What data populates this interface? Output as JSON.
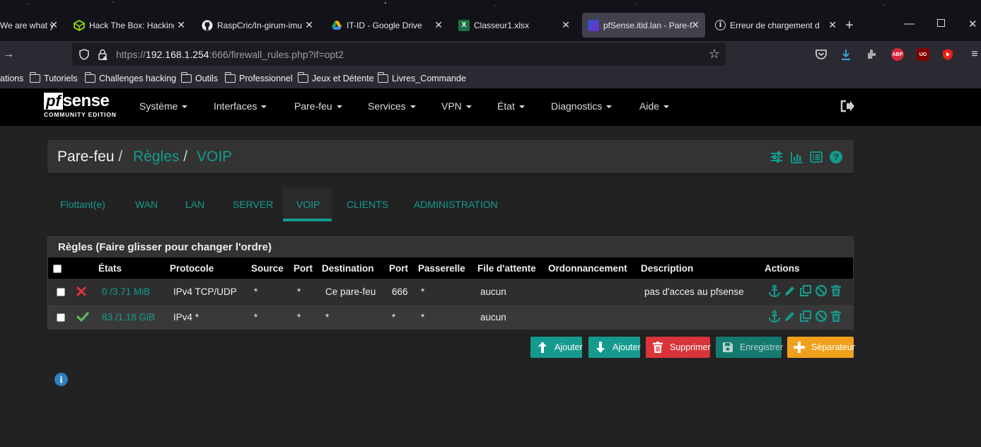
{
  "browser": {
    "tabs": [
      {
        "label": "We are what y",
        "favicon": "generic"
      },
      {
        "label": "Hack The Box: Hacking",
        "favicon": "htb-cube"
      },
      {
        "label": "RaspCric/In-girum-imu",
        "favicon": "github"
      },
      {
        "label": "IT-ID - Google Drive",
        "favicon": "google-drive"
      },
      {
        "label": "Classeur1.xlsx",
        "favicon": "excel"
      },
      {
        "label": "pfSense.itid.lan - Pare-f",
        "favicon": "pfsense",
        "active": true
      },
      {
        "label": "Erreur de chargement d",
        "favicon": "info"
      }
    ],
    "url_prefix": "https://",
    "url_host": "192.168.1.254",
    "url_rest": ":666/firewall_rules.php?if=opt2",
    "toolbar_badges": {
      "abp": "ABP",
      "ublock": "UO"
    },
    "bookmarks": [
      {
        "label": "ations",
        "type": "plain"
      },
      {
        "label": "Tutoriels",
        "type": "folder"
      },
      {
        "label": "Challenges hacking",
        "type": "folder"
      },
      {
        "label": "Outils",
        "type": "folder"
      },
      {
        "label": "Professionnel",
        "type": "folder"
      },
      {
        "label": "Jeux et Détente",
        "type": "folder"
      },
      {
        "label": "Livres_Commande",
        "type": "folder"
      }
    ]
  },
  "pfsense": {
    "logo_pf": "pf",
    "logo_sense": "sense",
    "logo_edition": "COMMUNITY EDITION",
    "menu": [
      "Système",
      "Interfaces",
      "Pare-feu",
      "Services",
      "VPN",
      "État",
      "Diagnostics",
      "Aide"
    ],
    "breadcrumb": [
      "Pare-feu",
      "Règles",
      "VOIP"
    ],
    "breadcrumb_sep": "/",
    "subtabs": [
      "Flottant(e)",
      "WAN",
      "LAN",
      "SERVER",
      "VOIP",
      "CLIENTS",
      "ADMINISTRATION"
    ],
    "active_subtab": "VOIP",
    "panel_title": "Règles (Faire glisser pour changer l'ordre)",
    "columns": [
      "États",
      "Protocole",
      "Source",
      "Port",
      "Destination",
      "Port",
      "Passerelle",
      "File d'attente",
      "Ordonnancement",
      "Description",
      "Actions"
    ],
    "rules": [
      {
        "enabled": false,
        "status_icon": "times-icon",
        "states": "0 /3.71 MiB",
        "protocol": "IPv4 TCP/UDP",
        "source": "*",
        "source_port": "*",
        "destination": "Ce pare-feu",
        "dest_port": "666",
        "gateway": "*",
        "queue": "aucun",
        "schedule": "",
        "description": "pas d'acces au pfsense"
      },
      {
        "enabled": true,
        "status_icon": "check-icon",
        "states": "83 /1.18 GiB",
        "protocol": "IPv4 *",
        "source": "*",
        "source_port": "*",
        "destination": "*",
        "dest_port": "*",
        "gateway": "*",
        "queue": "aucun",
        "schedule": "",
        "description": ""
      }
    ],
    "buttons": {
      "add_top": "Ajouter",
      "add_bottom": "Ajouter",
      "delete": "Supprimer",
      "save": "Enregistrer",
      "separator": "Séparateur"
    },
    "colors": {
      "accent": "#159b8d",
      "danger": "#d9343a",
      "warning": "#f0a01a",
      "save_disabled": "#147a6f",
      "success_check": "#5cb85c",
      "info": "#2f7fc1"
    }
  }
}
